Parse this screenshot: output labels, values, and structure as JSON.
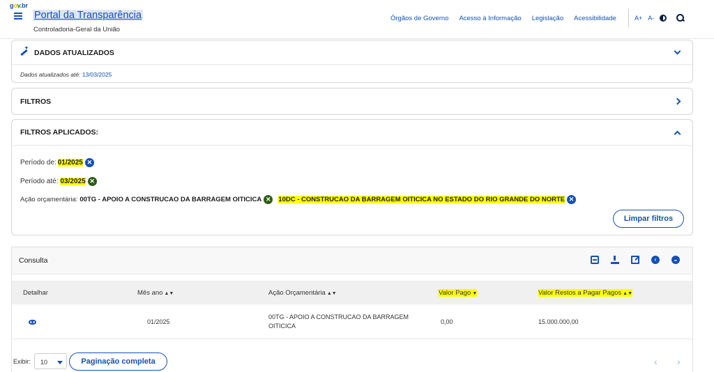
{
  "header": {
    "logo": "gov.br",
    "title": "Portal da Transparência",
    "subtitle": "Controladoria-Geral da União",
    "nav": [
      "Órgãos de Governo",
      "Acesso à Informação",
      "Legislação",
      "Acessibilidade"
    ],
    "font_increase": "A+",
    "font_decrease": "A-"
  },
  "dados": {
    "title": "DADOS ATUALIZADOS",
    "updated_label": "Dados atualizados até:",
    "updated_date": "13/03/2025"
  },
  "filtros": {
    "title": "FILTROS"
  },
  "aplicados": {
    "title": "FILTROS APLICADOS:",
    "periodo_de_label": "Período de:",
    "periodo_de_value": "01/2025",
    "periodo_ate_label": "Período até:",
    "periodo_ate_value": "03/2025",
    "acao_label": "Ação orçamentária:",
    "acao_1": "00TG - APOIO A CONSTRUCAO DA BARRAGEM OITICICA",
    "acao_2": "10DC - CONSTRUCAO DA BARRAGEM OITICICA NO ESTADO DO RIO GRANDE DO NORTE",
    "clear_button": "Limpar filtros"
  },
  "consulta": {
    "title": "Consulta",
    "columns": [
      "Detalhar",
      "Mês ano",
      "Ação Orçamentária",
      "Valor Pago",
      "Valor Restos a Pagar Pagos"
    ],
    "rows": [
      {
        "mes_ano": "01/2025",
        "acao_line1": "00TG - APOIO A CONSTRUCAO DA BARRAGEM",
        "acao_line2": "OITICICA",
        "valor_pago": "0,00",
        "restos": "15.000.000,00"
      }
    ]
  },
  "pager": {
    "show_label": "Exibir:",
    "page_size": "10",
    "full_pagination": "Paginação completa",
    "prev": "‹",
    "next": "›"
  },
  "colors": {
    "primary": "#1351b4",
    "highlight": "#ffff00",
    "header_bg": "#f0f0f0"
  }
}
